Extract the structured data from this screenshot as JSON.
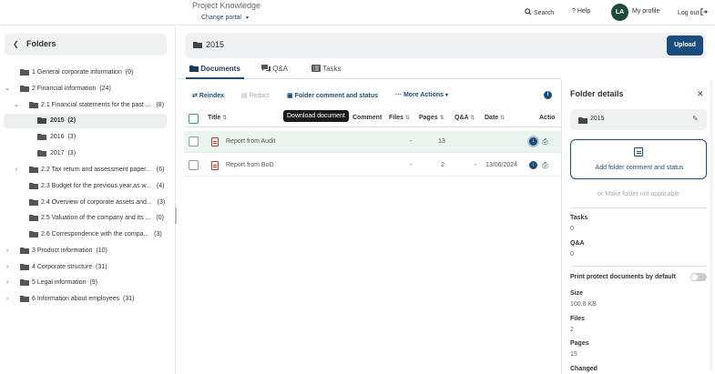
{
  "header": {
    "title": "Project Knowledge",
    "portal_label": "Change portal",
    "search_label": "Search",
    "help_label": "Help",
    "avatar_initials": "LA",
    "profile_label": "My profile",
    "logout_label": "Log out"
  },
  "sidebar": {
    "title": "Folders",
    "items": [
      {
        "label": "1 General corporate information",
        "count": "(0)"
      },
      {
        "label": "2 Financial information",
        "count": "(24)"
      },
      {
        "label": "2.1 Financial statements for the past ...",
        "count": "(8)"
      },
      {
        "label": "2015",
        "count": "(2)"
      },
      {
        "label": "2016",
        "count": "(3)"
      },
      {
        "label": "2017",
        "count": "(3)"
      },
      {
        "label": "2.2 Tax return and assessment paper...",
        "count": "(6)"
      },
      {
        "label": "2.3 Budget for the previous year,as w...",
        "count": "(4)"
      },
      {
        "label": "2.4 Overview of corporate assets and...",
        "count": "(3)"
      },
      {
        "label": "2.5 Valuation of the company and its ...",
        "count": "(0)"
      },
      {
        "label": "2.6 Correspondence with the compa...",
        "count": "(3)"
      },
      {
        "label": "3 Product information",
        "count": "(10)"
      },
      {
        "label": "4 Corporate structure",
        "count": "(31)"
      },
      {
        "label": "5 Legal information",
        "count": "(9)"
      },
      {
        "label": "6 Information about employees",
        "count": "(31)"
      }
    ]
  },
  "main": {
    "folder_title": "2015",
    "upload_label": "Upload",
    "tabs": [
      {
        "label": "Documents"
      },
      {
        "label": "Q&A"
      },
      {
        "label": "Tasks"
      }
    ],
    "toolbar": {
      "reindex": "Reindex",
      "redact": "Redact",
      "folder_comment": "Folder comment and status",
      "more_actions": "More Actions"
    },
    "table": {
      "headers": {
        "title": "Title",
        "comment": "Comment",
        "files": "Files",
        "pages": "Pages",
        "qa": "Q&A",
        "date": "Date",
        "actions": "Actio"
      },
      "rows": [
        {
          "title": "Report from Audit",
          "files": "-",
          "pages": "13",
          "qa": "",
          "date": ""
        },
        {
          "title": "Report from BoD",
          "files": "-",
          "pages": "2",
          "qa": "-",
          "date": "13/06/2024"
        }
      ]
    },
    "tooltip": "Download document"
  },
  "panel": {
    "title": "Folder details",
    "folder_name": "2015",
    "add_comment": "Add folder comment and status",
    "not_applicable": "or Make folder not applicable",
    "tasks_label": "Tasks",
    "tasks_value": "0",
    "qa_label": "Q&A",
    "qa_value": "0",
    "print_protect_label": "Print protect documents by default",
    "size_label": "Size",
    "size_value": "100.8 KB",
    "files_label": "Files",
    "files_value": "2",
    "pages_label": "Pages",
    "pages_value": "15",
    "changed_label": "Changed"
  }
}
